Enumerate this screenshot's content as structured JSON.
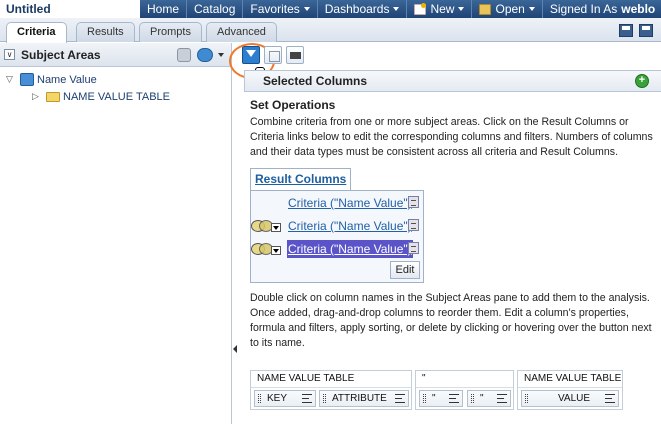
{
  "app": {
    "title": "Untitled"
  },
  "topnav": {
    "items": [
      "Home",
      "Catalog",
      "Favorites",
      "Dashboards",
      "New",
      "Open",
      "Signed In As"
    ],
    "user": "weblo"
  },
  "tabs": [
    "Criteria",
    "Results",
    "Prompts",
    "Advanced"
  ],
  "left_pane": {
    "title": "Subject Areas",
    "tree": [
      {
        "label": "Name Value",
        "icon": "database-icon",
        "expanded": true
      },
      {
        "label": "NAME VALUE TABLE",
        "icon": "folder-icon",
        "expanded": false
      }
    ]
  },
  "selected_columns": {
    "title": "Selected Columns",
    "set_operations_title": "Set Operations",
    "set_operations_desc": "Combine criteria from one or more subject areas. Click on the Result Columns or Criteria links below to edit the corresponding columns and filters. Numbers of columns and their data types must be consistent across all criteria and Result Columns.",
    "result_columns_label": "Result Columns",
    "criteria": [
      "Criteria (\"Name Value\")",
      "Criteria (\"Name Value\")",
      "Criteria (\"Name Value\")"
    ],
    "edit_label": "Edit",
    "help_text": "Double click on column names in the Subject Areas pane to add them to the analysis. Once added, drag-and-drop columns to reorder them. Edit a column's properties, formula and filters, apply sorting, or delete by clicking or hovering over the button next to its name."
  },
  "columns_table": {
    "groups": [
      {
        "title": "NAME VALUE TABLE",
        "cells": [
          "KEY",
          "ATTRIBUTE"
        ]
      },
      {
        "title": "\"",
        "cells": [
          "\"",
          "\""
        ]
      },
      {
        "title": "NAME VALUE TABLE",
        "cells": [
          "VALUE"
        ]
      }
    ]
  }
}
